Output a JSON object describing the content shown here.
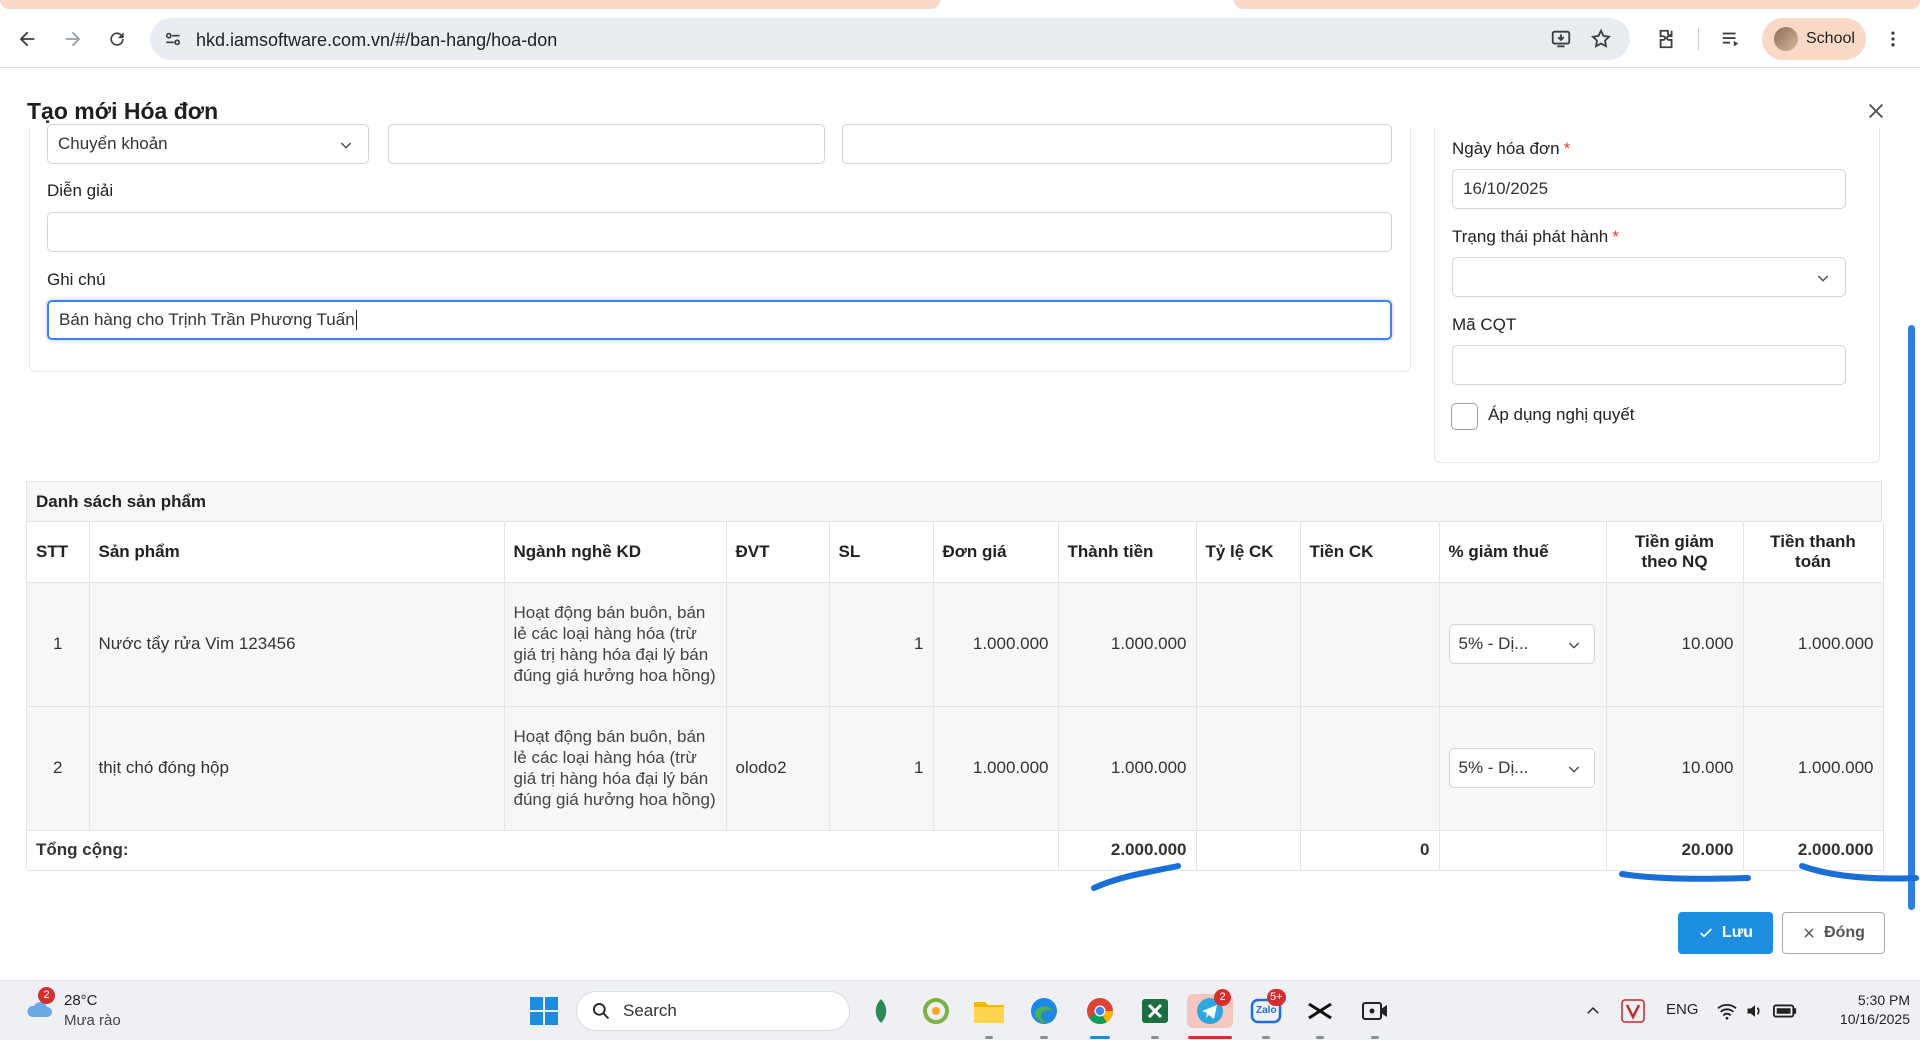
{
  "browser": {
    "url": "hkd.iamsoftware.com.vn/#/ban-hang/hoa-don",
    "profile_label": "School"
  },
  "modal": {
    "title": "Tạo mới Hóa đơn",
    "payment_method": "Chuyển khoản",
    "field_2_value": "",
    "field_3_value": "",
    "description_label": "Diễn giải",
    "description_value": "",
    "note_label": "Ghi chú",
    "note_value": "Bán hàng cho Trịnh Trần Phương Tuấn",
    "invoice_date_label": "Ngày hóa đơn",
    "invoice_date_value": "16/10/2025",
    "release_status_label": "Trạng thái phát hành",
    "release_status_value": "",
    "tax_code_label": "Mã CQT",
    "tax_code_value": "",
    "apply_resolution_label": "Áp dụng nghị quyết",
    "required_mark": "*"
  },
  "products": {
    "caption": "Danh sách sản phẩm",
    "columns": {
      "stt": "STT",
      "product": "Sản phẩm",
      "industry": "Ngành nghề KD",
      "unit": "ĐVT",
      "qty": "SL",
      "price": "Đơn giá",
      "amount": "Thành tiền",
      "discount_rate": "Tỷ lệ CK",
      "discount_amount": "Tiền CK",
      "tax_reduction": "% giảm thuế",
      "reduction_nq": "Tiền giảm theo NQ",
      "payment": "Tiền thanh toán"
    },
    "rows": [
      {
        "stt": "1",
        "product": "Nước tẩy rửa Vim 123456",
        "industry": "Hoạt động bán buôn, bán lẻ các loại hàng hóa (trừ giá trị hàng hóa đại lý bán đúng giá hưởng hoa hồng)",
        "unit": "",
        "qty": "1",
        "price": "1.000.000",
        "amount": "1.000.000",
        "discount_rate": "",
        "discount_amount": "",
        "tax_reduction": "5% - Dị...",
        "reduction_nq": "10.000",
        "payment": "1.000.000"
      },
      {
        "stt": "2",
        "product": "thịt chó đóng hộp",
        "industry": "Hoạt động bán buôn, bán lẻ các loại hàng hóa (trừ giá trị hàng hóa đại lý bán đúng giá hưởng hoa hồng)",
        "unit": "olodo2",
        "qty": "1",
        "price": "1.000.000",
        "amount": "1.000.000",
        "discount_rate": "",
        "discount_amount": "",
        "tax_reduction": "5% - Dị...",
        "reduction_nq": "10.000",
        "payment": "1.000.000"
      }
    ],
    "total": {
      "label": "Tổng cộng:",
      "amount": "2.000.000",
      "discount_amount": "0",
      "reduction_nq": "20.000",
      "payment": "2.000.000"
    }
  },
  "actions": {
    "save_label": "Lưu",
    "close_label": "Đóng"
  },
  "taskbar": {
    "weather_temp": "28°C",
    "weather_condition": "Mưa rào",
    "weather_badge": "2",
    "search_placeholder": "Search",
    "telegram_badge": "2",
    "zalo_badge": "5+",
    "zalo_text": "Zalo",
    "language": "ENG",
    "time": "5:30 PM",
    "date": "10/16/2025"
  },
  "colors": {
    "accent": "#1e8fe0",
    "focus_border": "#3b82f6",
    "required": "#e53935",
    "annotation_pen": "#1a6fd6"
  }
}
